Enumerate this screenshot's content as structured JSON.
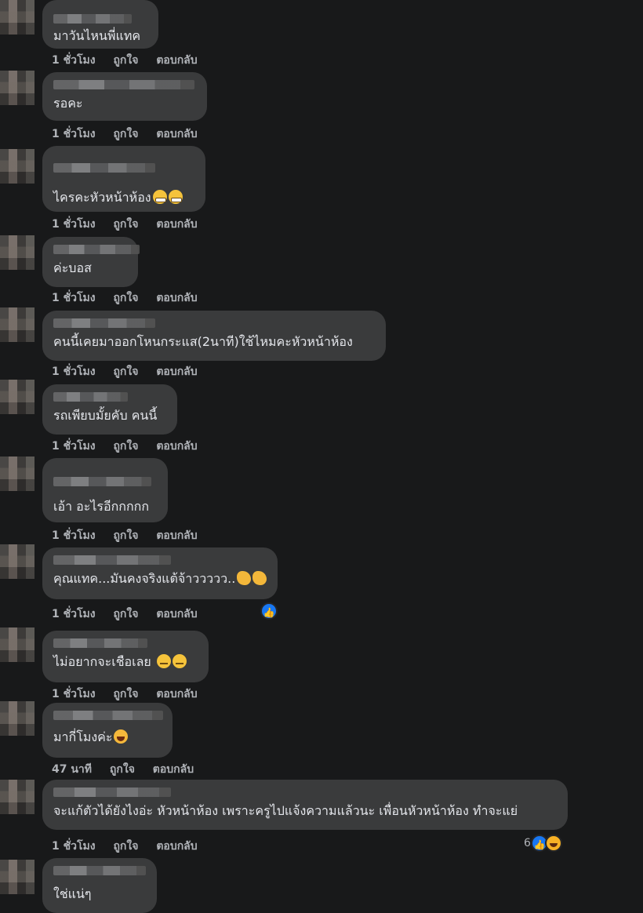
{
  "actions": {
    "like": "ถูกใจ",
    "reply": "ตอบกลับ"
  },
  "icons": {
    "like": "thumbs-up-icon",
    "haha": "laughing-face-icon"
  },
  "colors": {
    "background": "#18191a",
    "bubble": "#3a3b3c",
    "meta": "#b0b3b8",
    "like_blue": "#1877f2"
  },
  "comments": [
    {
      "text": "มาวันไหนพี่แทค",
      "time": "1 ชั่วโมง"
    },
    {
      "text": "รอคะ",
      "time": "1 ชั่วโมง"
    },
    {
      "text": "ไครคะหัวหน้าห้อง",
      "time": "1 ชั่วโมง",
      "emoji": [
        "grimacing-face",
        "grimacing-face"
      ]
    },
    {
      "text": "ค่ะบอส",
      "time": "1 ชั่วโมง"
    },
    {
      "text": "คนนี้เคยมาออกโหนกระแส(2นาที)ใช้ไหมคะหัวหน้าห้อง",
      "time": "1 ชั่วโมง"
    },
    {
      "text": "รถเพียบมั้ยคับ คนนี้",
      "time": "1 ชั่วโมง"
    },
    {
      "text": "เอ้า อะไรอีกกกกก",
      "time": "1 ชั่วโมง"
    },
    {
      "text": "คุณแทค...มันคงจริงแต้จ้าววววว..",
      "time": "1 ชั่วโมง",
      "emoji": [
        "clapping-hands",
        "clapping-hands"
      ],
      "reaction": "like"
    },
    {
      "text": "ไม่อยากจะเชือเลย",
      "time": "1 ชั่วโมง",
      "emoji": [
        "sleepy-face",
        "sleepy-face"
      ]
    },
    {
      "text": "มากี่โมงค่ะ",
      "time": "47 นาที",
      "emoji": [
        "rolling-laughing-face"
      ]
    },
    {
      "text": "จะแก้ตัวได้ยังไงอ่ะ หัวหน้าห้อง เพราะครูไปแจ้งความแล้วนะ เพื่อนหัวหน้าห้อง ทำจะแย่",
      "time": "1 ชั่วโมง",
      "reaction_count": "6"
    },
    {
      "text": "ใช่แน่ๆ",
      "time": ""
    }
  ]
}
